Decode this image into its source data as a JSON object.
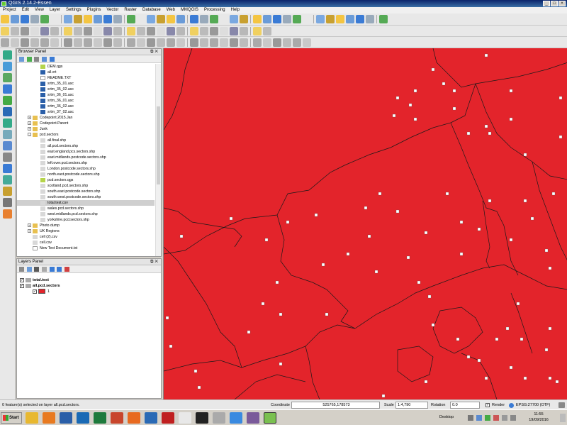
{
  "window": {
    "title": "QGIS 2.14.2-Essen"
  },
  "menubar": [
    "Project",
    "Edit",
    "View",
    "Layer",
    "Settings",
    "Plugins",
    "Vector",
    "Raster",
    "Database",
    "Web",
    "MMQGIS",
    "Processing",
    "Help"
  ],
  "browser_panel": {
    "title": "Browser Panel",
    "items": [
      {
        "label": "DEM.qgs",
        "icon": "qgs-project-icon",
        "indent": 3
      },
      {
        "label": "all.vrt",
        "icon": "raster-icon",
        "indent": 3
      },
      {
        "label": "README.TXT",
        "icon": "file-icon",
        "indent": 3
      },
      {
        "label": "srtm_35_01.asc",
        "icon": "raster-icon",
        "indent": 3
      },
      {
        "label": "srtm_35_02.asc",
        "icon": "raster-icon",
        "indent": 3
      },
      {
        "label": "srtm_36_01.asc",
        "icon": "raster-icon",
        "indent": 3
      },
      {
        "label": "srtm_36_01.asc",
        "icon": "raster-icon",
        "indent": 3
      },
      {
        "label": "srtm_36_02.asc",
        "icon": "raster-icon",
        "indent": 3
      },
      {
        "label": "srtm_37_02.asc",
        "icon": "raster-icon",
        "indent": 3
      },
      {
        "label": "Codepoint.2015.Jan",
        "icon": "folder-icon",
        "indent": 2,
        "expander": "+"
      },
      {
        "label": "Codepoint.Parent",
        "icon": "folder-icon",
        "indent": 2,
        "expander": "+"
      },
      {
        "label": "Junk",
        "icon": "folder-icon",
        "indent": 2,
        "expander": "+"
      },
      {
        "label": "pcd.sectors",
        "icon": "folder-icon",
        "indent": 2,
        "expander": "-"
      },
      {
        "label": "all.final.shp",
        "icon": "vector-icon",
        "indent": 3
      },
      {
        "label": "all.pcd.sectors.shp",
        "icon": "vector-icon",
        "indent": 3
      },
      {
        "label": "east.england.pcs.sectors.shp",
        "icon": "vector-icon",
        "indent": 3
      },
      {
        "label": "east.midlands.postcode.sectors.shp",
        "icon": "vector-icon",
        "indent": 3
      },
      {
        "label": "left.over.pcd.sectors.shp",
        "icon": "vector-icon",
        "indent": 3
      },
      {
        "label": "London.postcode.sectors.shp",
        "icon": "vector-icon",
        "indent": 3
      },
      {
        "label": "north.east.postcode.sectors.shp",
        "icon": "vector-icon",
        "indent": 3
      },
      {
        "label": "pcd.sectors.qgs",
        "icon": "qgs-project-icon",
        "indent": 3
      },
      {
        "label": "scotland.pcd.sectors.shp",
        "icon": "vector-icon",
        "indent": 3
      },
      {
        "label": "south.east.postcode.sectors.shp",
        "icon": "vector-icon",
        "indent": 3
      },
      {
        "label": "south.west.postcode.sectors.shp",
        "icon": "vector-icon",
        "indent": 3
      },
      {
        "label": "total.test.csv",
        "icon": "vector-icon",
        "indent": 3,
        "selected": true
      },
      {
        "label": "wales.pcd.sectors.shp",
        "icon": "vector-icon",
        "indent": 3
      },
      {
        "label": "west.midlands.pcd.sectors.shp",
        "icon": "vector-icon",
        "indent": 3
      },
      {
        "label": "yorkshire.pcd.sectors.shp",
        "icon": "vector-icon",
        "indent": 3
      },
      {
        "label": "Photo dump",
        "icon": "folder-icon",
        "indent": 2,
        "expander": "+"
      },
      {
        "label": "UK Regions",
        "icon": "folder-icon",
        "indent": 2,
        "expander": "+"
      },
      {
        "label": "cell (2).csv",
        "icon": "vector-icon",
        "indent": 2
      },
      {
        "label": "cell.csv",
        "icon": "vector-icon",
        "indent": 2
      },
      {
        "label": "New Text Document.txt",
        "icon": "file-icon",
        "indent": 2
      }
    ]
  },
  "layers_panel": {
    "title": "Layers Panel",
    "layers": [
      {
        "label": "total.test",
        "checked": true,
        "bold": true
      },
      {
        "label": "all.pcd.sectors",
        "checked": true,
        "bold": true,
        "legend": {
          "label": "1",
          "color": "#e3242b"
        }
      }
    ]
  },
  "statusbar": {
    "message": "0 feature(s) selected on layer all.pcd.sectors.",
    "coordinate_label": "Coordinate",
    "coordinate": "525765,178573",
    "scale_label": "Scale",
    "scale": "1:4,790",
    "rotation_label": "Rotation",
    "rotation": "0.0",
    "render_label": "Render",
    "crs": "EPSG:27700 (OTF)"
  },
  "taskbar": {
    "start_label": "Start",
    "desktop_label": "Desktop",
    "time": "11:55",
    "date": "19/09/2016"
  },
  "map": {
    "fill_color": "#e3242b",
    "point_color": "#ffffff",
    "boundary_color": "#1a1a1a"
  }
}
